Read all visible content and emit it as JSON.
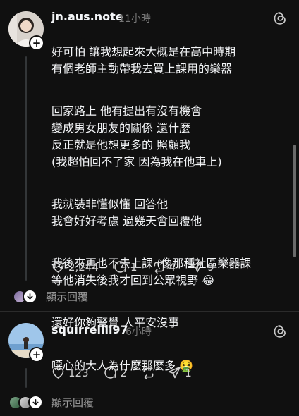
{
  "posts": [
    {
      "username": "jn.aus.note",
      "time": "11小時",
      "paragraphs": [
        "好可怕 讓我想起來大概是在高中時期\n有個老師主動帶我去買上課用的樂器",
        "回家路上 他有提出有沒有機會\n變成男女朋友的關係 還什麼\n反正就是他想更多的 照顧我\n(我超怕回不了家 因為我在他車上)",
        "我就裝非懂似懂 回答他\n我會好好考慮 過幾天會回覆他",
        "我後來再也不去上課 (像那種社區樂器課\n等他消失後我才回到公眾視野 😂",
        "還好你夠警覺 人平安沒事"
      ],
      "likes": "2,244",
      "comments": "1",
      "reposts": "4",
      "shares": "9",
      "view_replies": "顯示回覆"
    },
    {
      "username": "squirrellll97",
      "time": "6小時",
      "paragraphs": [
        "噁心的大人為什麼那麼多 🤮"
      ],
      "likes": "123",
      "comments": "2",
      "reposts": "",
      "shares": "1",
      "view_replies": "顯示回覆"
    }
  ],
  "icons": {
    "like": "heart-icon",
    "comment": "comment-icon",
    "repost": "repost-icon",
    "share": "share-icon",
    "brand": "threads-icon",
    "follow": "plus-icon",
    "expand": "chevron-down-icon"
  },
  "colors": {
    "background": "#101010",
    "text": "#f3f5f7",
    "muted": "#777777"
  }
}
